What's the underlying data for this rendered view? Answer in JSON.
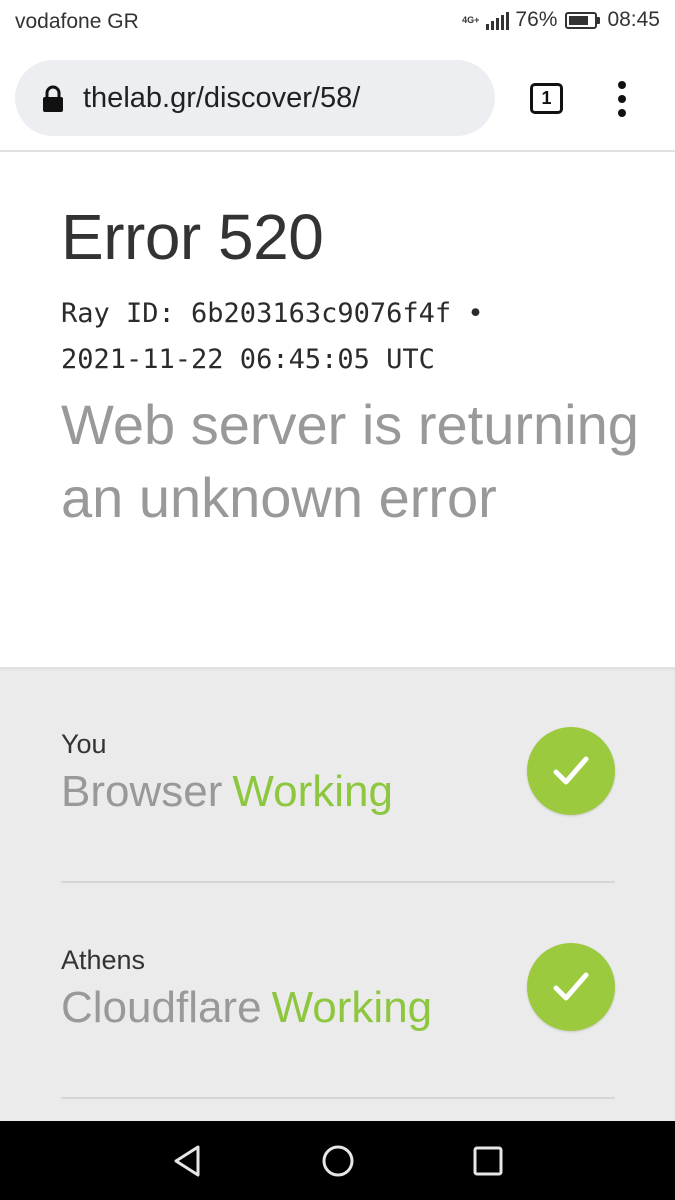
{
  "status_bar": {
    "carrier": "vodafone GR",
    "network_type": "4G+",
    "battery_percent": "76%",
    "battery_level": 0.76,
    "time": "08:45"
  },
  "browser": {
    "url": "thelab.gr/discover/58/",
    "tab_count": "1"
  },
  "error": {
    "title": "Error 520",
    "ray_line_1": "Ray ID: 6b203163c9076f4f •",
    "ray_line_2": "2021-11-22 06:45:05 UTC",
    "description": "Web server is returning an unknown error"
  },
  "status_items": [
    {
      "location": "You",
      "service": "Browser",
      "status": "Working"
    },
    {
      "location": "Athens",
      "service": "Cloudflare",
      "status": "Working"
    }
  ],
  "colors": {
    "working_green": "#8dc63f",
    "check_circle": "#9bca3e",
    "panel_bg": "#ebebeb"
  },
  "icons": {
    "lock": "lock-icon",
    "menu": "more-vert-icon",
    "check": "check-icon",
    "nav_back": "back-triangle-icon",
    "nav_home": "home-circle-icon",
    "nav_recent": "recents-square-icon"
  }
}
